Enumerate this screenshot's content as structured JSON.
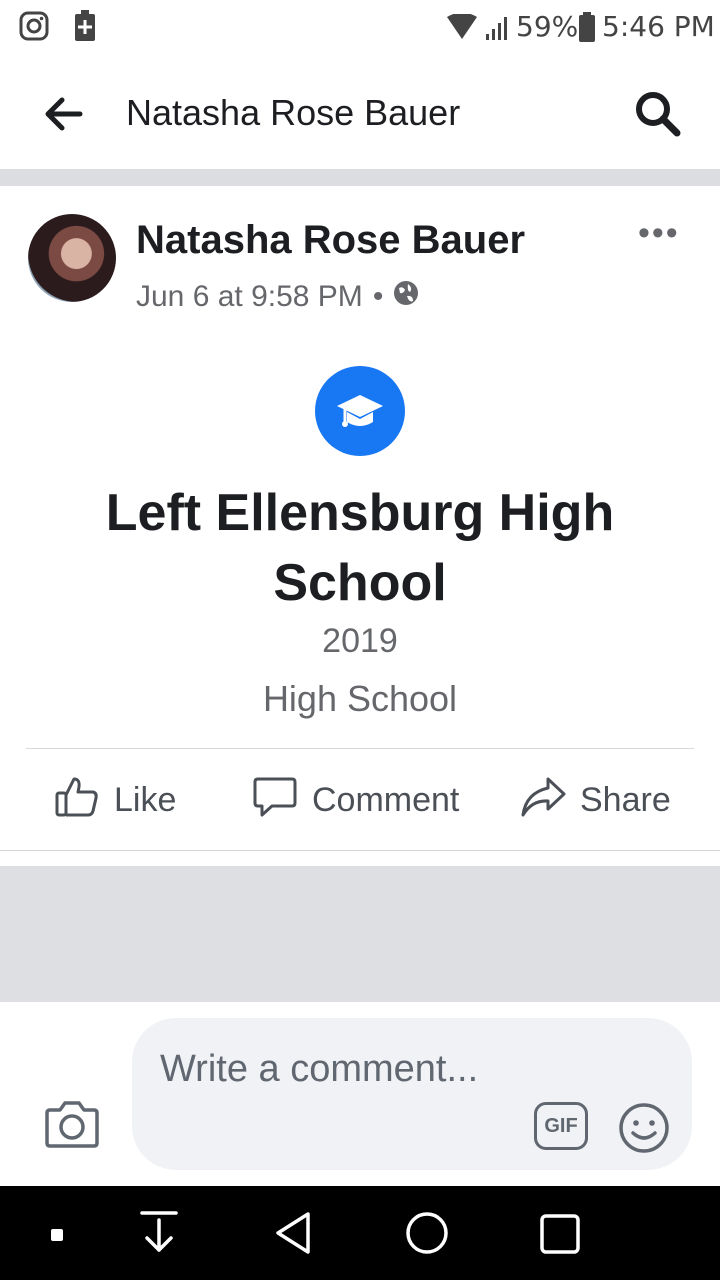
{
  "status_bar": {
    "battery": "59%",
    "time": "5:46 PM",
    "icons": [
      "instagram-icon",
      "battery-saver-icon",
      "wifi-icon",
      "signal-icon",
      "battery-icon"
    ]
  },
  "header": {
    "title": "Natasha Rose Bauer",
    "icons": [
      "back-arrow-icon",
      "search-icon"
    ]
  },
  "post": {
    "author": "Natasha Rose Bauer",
    "timestamp": "Jun 6 at 9:58 PM",
    "separator": "•",
    "privacy_icon": "globe-icon",
    "more_label": "•••",
    "life_event": {
      "icon": "graduation-cap-icon",
      "title": "Left Ellensburg High School",
      "year": "2019",
      "type": "High School"
    },
    "actions": {
      "like": "Like",
      "comment": "Comment",
      "share": "Share"
    }
  },
  "composer": {
    "placeholder": "Write a comment...",
    "gif_label": "GIF",
    "icons": [
      "camera-icon",
      "emoji-icon"
    ]
  },
  "nav_bar": {
    "icons": [
      "notification-dot-icon",
      "download-icon",
      "back-nav-icon",
      "home-nav-icon",
      "recents-nav-icon"
    ]
  },
  "colors": {
    "brand_blue": "#1877f2",
    "secondary_text": "#65676b",
    "band_gray": "#dddfe2"
  }
}
